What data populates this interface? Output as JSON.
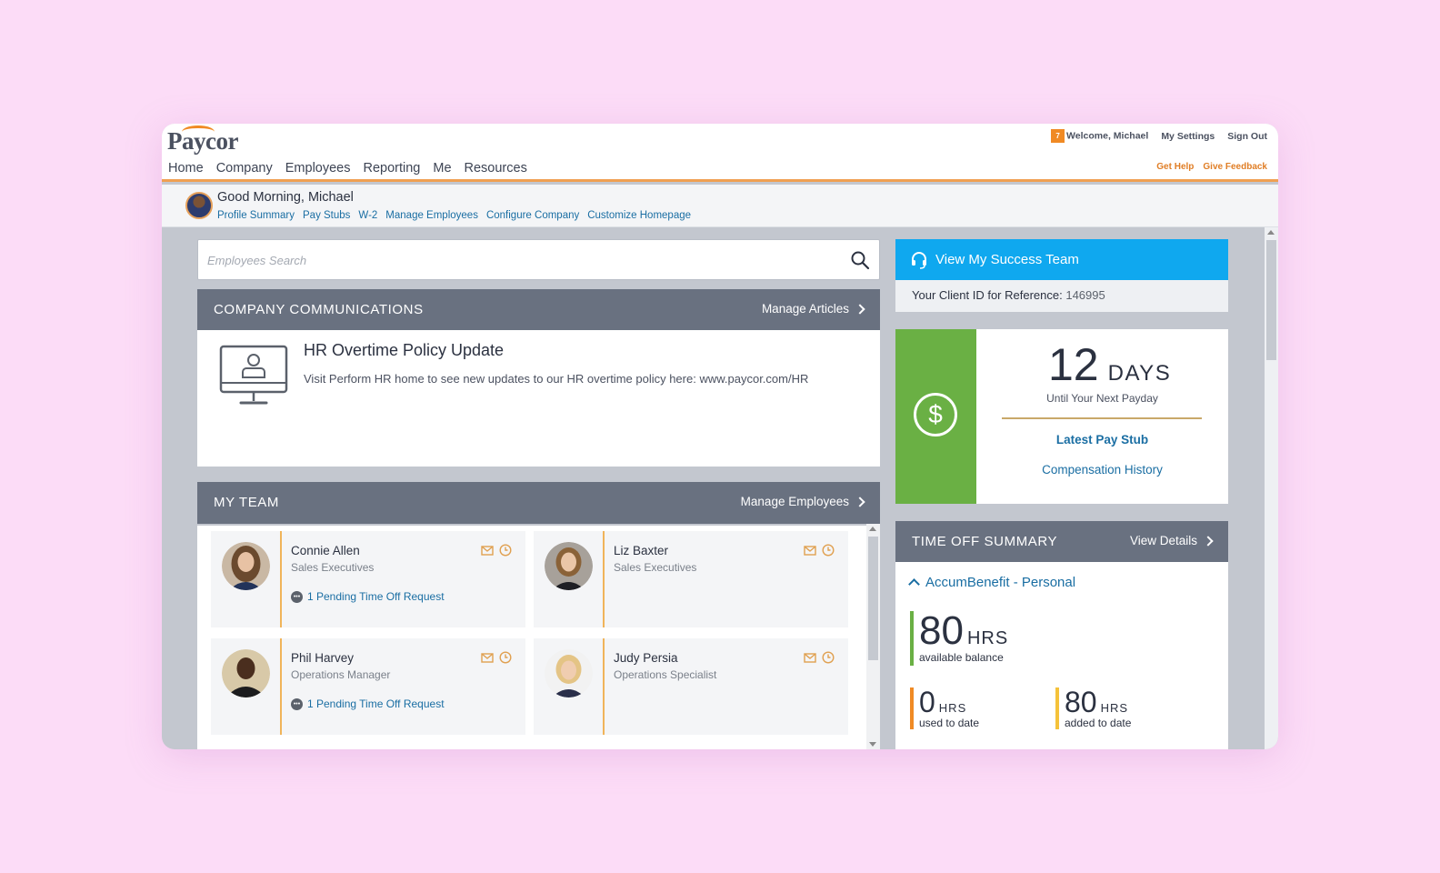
{
  "app": {
    "logo": "Paycor"
  },
  "nav": {
    "items": [
      "Home",
      "Company",
      "Employees",
      "Reporting",
      "Me",
      "Resources"
    ]
  },
  "user": {
    "notification_count": "7",
    "welcome": "Welcome, Michael",
    "settings": "My Settings",
    "signout": "Sign Out",
    "get_help": "Get Help",
    "give_feedback": "Give Feedback"
  },
  "greeting": {
    "title": "Good Morning, Michael",
    "links": [
      "Profile Summary",
      "Pay Stubs",
      "W-2",
      "Manage Employees",
      "Configure Company",
      "Customize Homepage"
    ]
  },
  "search": {
    "placeholder": "Employees Search"
  },
  "communications": {
    "header": "COMPANY COMMUNICATIONS",
    "action": "Manage Articles",
    "article_title": "HR Overtime Policy Update",
    "article_text": "Visit Perform HR home to see new updates to our HR overtime policy here: www.paycor.com/HR"
  },
  "team": {
    "header": "MY TEAM",
    "action": "Manage Employees",
    "members": [
      {
        "name": "Connie Allen",
        "role": "Sales Executives",
        "pending": "1 Pending Time Off Request"
      },
      {
        "name": "Liz Baxter",
        "role": "Sales Executives",
        "pending": ""
      },
      {
        "name": "Phil Harvey",
        "role": "Operations Manager",
        "pending": "1 Pending Time Off Request"
      },
      {
        "name": "Judy Persia",
        "role": "Operations Specialist",
        "pending": ""
      }
    ]
  },
  "success_team": {
    "label": "View My Success Team",
    "client_id_label": "Your Client ID for Reference:",
    "client_id": "146995"
  },
  "payday": {
    "count": "12",
    "unit": "DAYS",
    "caption": "Until Your Next Payday",
    "latest_stub": "Latest Pay Stub",
    "comp_history": "Compensation History"
  },
  "time_off": {
    "header": "TIME OFF SUMMARY",
    "action": "View Details",
    "plan": "AccumBenefit - Personal",
    "available": {
      "value": "80",
      "unit": "HRS",
      "label": "available balance"
    },
    "used": {
      "value": "0",
      "unit": "HRS",
      "label": "used to date"
    },
    "added": {
      "value": "80",
      "unit": "HRS",
      "label": "added to date"
    }
  },
  "colors": {
    "accent_orange": "#f08a24",
    "link_blue": "#1a6ea3",
    "success_blue": "#0fa8ef",
    "payday_green": "#6ab044",
    "panel_header": "#697180"
  }
}
